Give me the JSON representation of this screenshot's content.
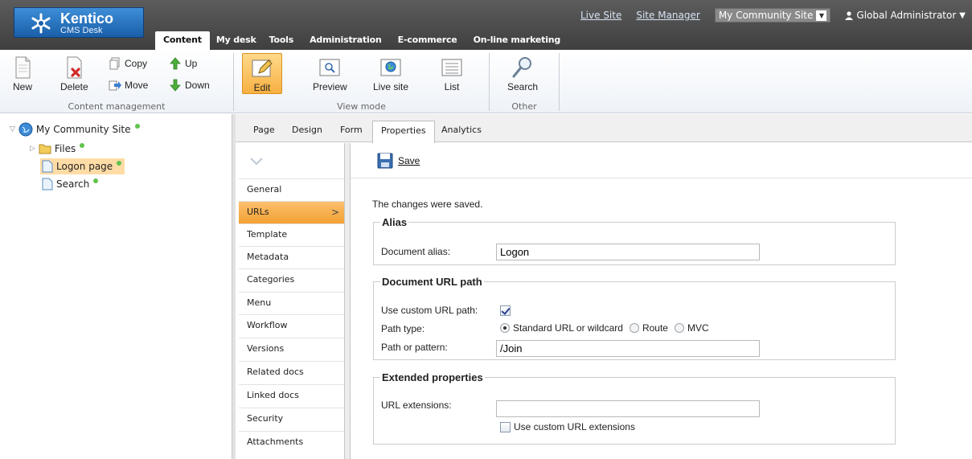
{
  "header": {
    "brand": "Kentico",
    "product": "CMS Desk",
    "links": {
      "live_site": "Live Site",
      "site_manager": "Site Manager"
    },
    "site_selector": "My Community Site",
    "user": "Global Administrator",
    "tabs": [
      "Content",
      "My desk",
      "Tools",
      "Administration",
      "E-commerce",
      "On-line marketing"
    ]
  },
  "ribbon": {
    "content_management": {
      "title": "Content management",
      "new": "New",
      "delete": "Delete",
      "copy": "Copy",
      "move": "Move",
      "up": "Up",
      "down": "Down"
    },
    "view_mode": {
      "title": "View mode",
      "edit": "Edit",
      "preview": "Preview",
      "live_site": "Live site",
      "list": "List"
    },
    "other": {
      "title": "Other",
      "search": "Search"
    }
  },
  "tree": {
    "root": "My Community Site",
    "items": [
      "Files",
      "Logon page",
      "Search"
    ]
  },
  "content_tabs": [
    "Page",
    "Design",
    "Form",
    "Properties",
    "Analytics"
  ],
  "properties_menu": [
    "General",
    "URLs",
    "Template",
    "Metadata",
    "Categories",
    "Menu",
    "Workflow",
    "Versions",
    "Related docs",
    "Linked docs",
    "Security",
    "Attachments"
  ],
  "form": {
    "save_label": "Save",
    "message": "The changes were saved.",
    "alias": {
      "legend": "Alias",
      "label": "Document alias:",
      "value": "Logon"
    },
    "url_path": {
      "legend": "Document URL path",
      "use_custom_label": "Use custom URL path:",
      "use_custom_checked": true,
      "path_type_label": "Path type:",
      "path_type_options": [
        "Standard URL or wildcard",
        "Route",
        "MVC"
      ],
      "path_type_selected": "Standard URL or wildcard",
      "pattern_label": "Path or pattern:",
      "pattern_value": "/Join"
    },
    "extended": {
      "legend": "Extended properties",
      "extensions_label": "URL extensions:",
      "extensions_value": "",
      "use_custom_ext_label": "Use custom URL extensions",
      "use_custom_ext_checked": false
    }
  },
  "colors": {
    "accent_orange": "#f3a033",
    "brand_blue": "#1a5ea8",
    "status_green": "#61c24d"
  }
}
